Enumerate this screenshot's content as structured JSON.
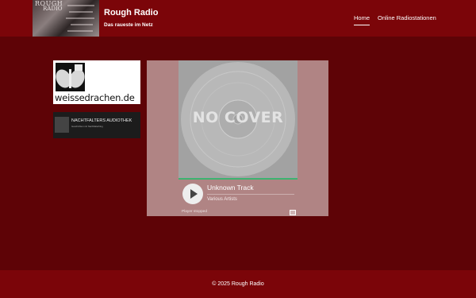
{
  "header": {
    "logo_line1": "ROUGH",
    "logo_line2": "RADIO",
    "title": "Rough Radio",
    "subtitle": "Das raueste im Netz",
    "nav": [
      {
        "label": "Home",
        "active": true
      },
      {
        "label": "Online Radiostationen",
        "active": false
      }
    ]
  },
  "sidebar": {
    "banner1_text": "weissedrachen.de",
    "banner2_title": "NACHTFALTERS AUDIOTHEK",
    "banner2_sub": "Geschichten mit Nachtfalterblog"
  },
  "player": {
    "cover_text": "NO COVER",
    "track_title": "Unknown Track",
    "artist": "Various Artists",
    "status": "Player stopped",
    "progress_color": "#3cb371"
  },
  "footer": {
    "text": "© 2025 Rough Radio"
  },
  "colors": {
    "header_bg": "#7b0509",
    "page_bg": "#5e0306",
    "player_bg": "#b08484"
  }
}
